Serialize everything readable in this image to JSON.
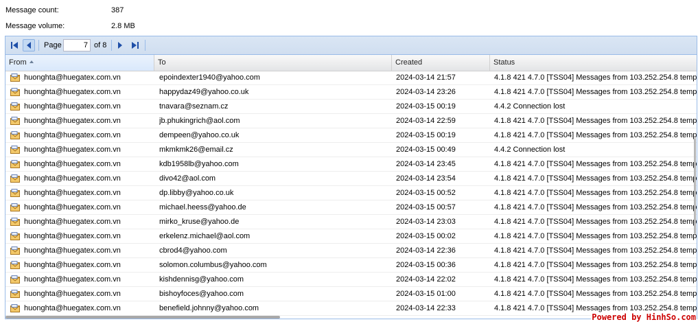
{
  "stats": [
    {
      "label": "Message count:",
      "value": "387"
    },
    {
      "label": "Message volume:",
      "value": "2.8 MB"
    }
  ],
  "toolbar": {
    "page_label": "Page",
    "current_page": "7",
    "of_label": "of 8",
    "buttons": [
      "first-page",
      "previous-page",
      "next-page",
      "last-page"
    ]
  },
  "columns": [
    "From",
    "To",
    "Created",
    "Status"
  ],
  "sorted_column": "From",
  "sort_direction": "ascending",
  "rows": [
    {
      "from": "huonghta@huegatex.com.vn",
      "to": "epoindexter1940@yahoo.com",
      "created": "2024-03-14 21:57",
      "status": "4.1.8 421 4.7.0 [TSS04] Messages from 103.252.254.8 temp"
    },
    {
      "from": "huonghta@huegatex.com.vn",
      "to": "happydaz49@yahoo.co.uk",
      "created": "2024-03-14 23:26",
      "status": "4.1.8 421 4.7.0 [TSS04] Messages from 103.252.254.8 temp"
    },
    {
      "from": "huonghta@huegatex.com.vn",
      "to": "tnavara@seznam.cz",
      "created": "2024-03-15 00:19",
      "status": "4.4.2 Connection lost"
    },
    {
      "from": "huonghta@huegatex.com.vn",
      "to": "jb.phukingrich@aol.com",
      "created": "2024-03-14 22:59",
      "status": "4.1.8 421 4.7.0 [TSS04] Messages from 103.252.254.8 temp"
    },
    {
      "from": "huonghta@huegatex.com.vn",
      "to": "dempeen@yahoo.co.uk",
      "created": "2024-03-15 00:19",
      "status": "4.1.8 421 4.7.0 [TSS04] Messages from 103.252.254.8 temp"
    },
    {
      "from": "huonghta@huegatex.com.vn",
      "to": "mkmkmk26@email.cz",
      "created": "2024-03-15 00:49",
      "status": "4.4.2 Connection lost"
    },
    {
      "from": "huonghta@huegatex.com.vn",
      "to": "kdb1958lb@yahoo.com",
      "created": "2024-03-14 23:45",
      "status": "4.1.8 421 4.7.0 [TSS04] Messages from 103.252.254.8 temp"
    },
    {
      "from": "huonghta@huegatex.com.vn",
      "to": "divo42@aol.com",
      "created": "2024-03-14 23:54",
      "status": "4.1.8 421 4.7.0 [TSS04] Messages from 103.252.254.8 temp"
    },
    {
      "from": "huonghta@huegatex.com.vn",
      "to": "dp.libby@yahoo.co.uk",
      "created": "2024-03-15 00:52",
      "status": "4.1.8 421 4.7.0 [TSS04] Messages from 103.252.254.8 temp"
    },
    {
      "from": "huonghta@huegatex.com.vn",
      "to": "michael.heess@yahoo.de",
      "created": "2024-03-15 00:57",
      "status": "4.1.8 421 4.7.0 [TSS04] Messages from 103.252.254.8 temp"
    },
    {
      "from": "huonghta@huegatex.com.vn",
      "to": "mirko_kruse@yahoo.de",
      "created": "2024-03-14 23:03",
      "status": "4.1.8 421 4.7.0 [TSS04] Messages from 103.252.254.8 temp"
    },
    {
      "from": "huonghta@huegatex.com.vn",
      "to": "erkelenz.michael@aol.com",
      "created": "2024-03-15 00:02",
      "status": "4.1.8 421 4.7.0 [TSS04] Messages from 103.252.254.8 temp"
    },
    {
      "from": "huonghta@huegatex.com.vn",
      "to": "cbrod4@yahoo.com",
      "created": "2024-03-14 22:36",
      "status": "4.1.8 421 4.7.0 [TSS04] Messages from 103.252.254.8 temp"
    },
    {
      "from": "huonghta@huegatex.com.vn",
      "to": "solomon.columbus@yahoo.com",
      "created": "2024-03-15 00:36",
      "status": "4.1.8 421 4.7.0 [TSS04] Messages from 103.252.254.8 temp"
    },
    {
      "from": "huonghta@huegatex.com.vn",
      "to": "kishdennisg@yahoo.com",
      "created": "2024-03-14 22:02",
      "status": "4.1.8 421 4.7.0 [TSS04] Messages from 103.252.254.8 temp"
    },
    {
      "from": "huonghta@huegatex.com.vn",
      "to": "bishoyfoces@yahoo.com",
      "created": "2024-03-15 01:00",
      "status": "4.1.8 421 4.7.0 [TSS04] Messages from 103.252.254.8 temp"
    },
    {
      "from": "huonghta@huegatex.com.vn",
      "to": "benefield.johnny@yahoo.com",
      "created": "2024-03-14 22:33",
      "status": "4.1.8 421 4.7.0 [TSS04] Messages from 103.252.254.8 temp"
    }
  ],
  "watermark": "Powered by HinhSo.com",
  "colors": {
    "border": "#99bbe8",
    "toolbar_bg": "#d0def0",
    "icon_blue": "#1f4fa8",
    "watermark": "#cc0000"
  },
  "row_icon": "envelope-icon"
}
